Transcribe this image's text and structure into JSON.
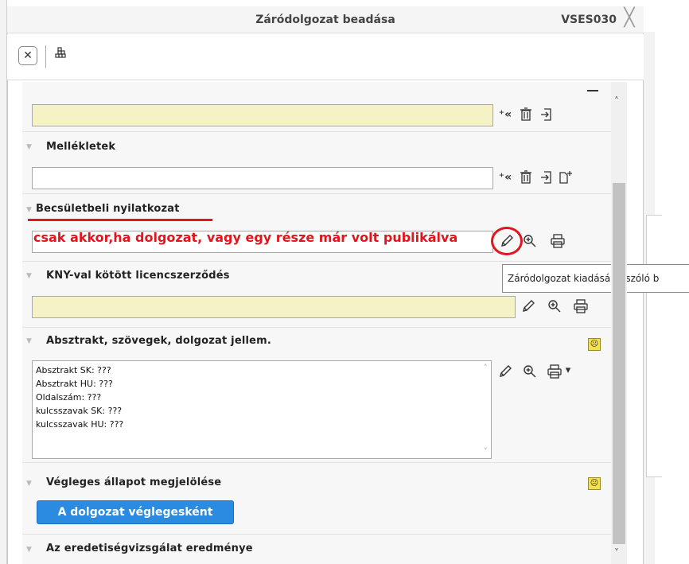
{
  "window": {
    "title": "Záródolgozat beadása",
    "code": "VSES030",
    "close_glyph": "╳"
  },
  "toolbar": {
    "close_glyph": "✕",
    "grid_icon": "grid-icon"
  },
  "sections": {
    "mellekletek": {
      "title": "Mellékletek"
    },
    "becsuleti": {
      "title": "Becsületbeli nyilatkozat",
      "annotation": "csak akkor,ha dolgozat, vagy egy része már volt publikálva"
    },
    "kny": {
      "title": "KNY-val kötött licencszerződés"
    },
    "absztrakt": {
      "title": "Absztrakt, szövegek, dolgozat jellem.",
      "lines": [
        "Absztrakt SK: ???",
        "Absztrakt HU: ???",
        "Oldalszám: ???",
        "kulcsszavak SK: ???",
        "kulcsszavak HU: ???"
      ]
    },
    "vegleges": {
      "title": "Végleges állapot megjelölése",
      "button_label": "A dolgozat véglegesként"
    },
    "eredetiseg": {
      "title": "Az eredetiségvizsgálat eredménye"
    }
  },
  "tooltip": {
    "text": "Záródolgozat kiadásáról szóló b"
  },
  "icons": {
    "add": "⁺«",
    "delete": "🗑",
    "import": "⇲",
    "new": "🗋",
    "edit": "✎",
    "zoom": "⊕",
    "print": "⎙",
    "dropdown": "▾",
    "sad": "☹",
    "scroll_up": "˄",
    "scroll_down": "˅",
    "ta_up": "˄",
    "ta_down": "˅"
  },
  "colors": {
    "accent_button": "#2a8be0",
    "annotation_red": "#e2151c",
    "field_yellow": "#f5f2c6"
  }
}
